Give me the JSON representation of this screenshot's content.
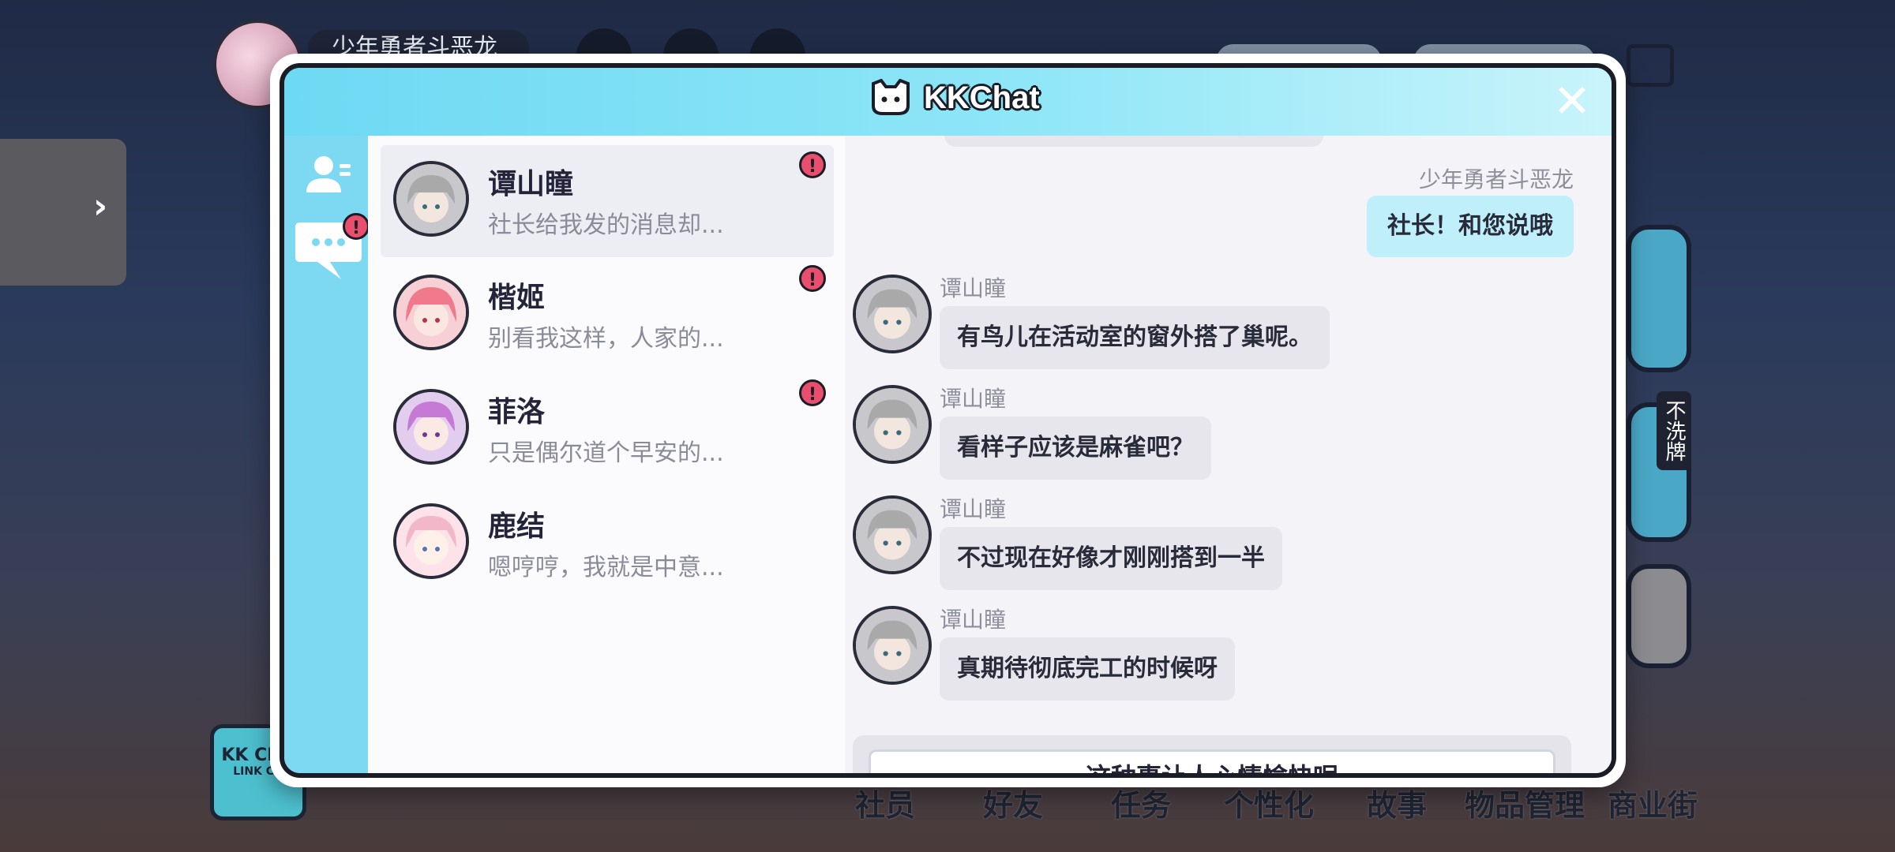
{
  "background": {
    "username": "少年勇者斗恶龙",
    "side_label": "不洗牌",
    "logo_text": "KK CHA",
    "logo_subtext": "LINK CH",
    "nav_tabs": [
      "社员",
      "好友",
      "任务",
      "个性化",
      "故事",
      "物品管理",
      "商业街"
    ]
  },
  "modal": {
    "title": "KKChat",
    "close_glyph": "✕",
    "badge_glyph": "!",
    "contacts": [
      {
        "name": "谭山瞳",
        "preview": "社长给我发的消息却...",
        "unread": true,
        "active": true,
        "hair": "#a9a9a9"
      },
      {
        "name": "楷姬",
        "preview": "别看我这样，人家的...",
        "unread": true,
        "active": false,
        "hair": "#f07a8c"
      },
      {
        "name": "菲洛",
        "preview": "只是偶尔道个早安的...",
        "unread": true,
        "active": false,
        "hair": "#c67ad6"
      },
      {
        "name": "鹿结",
        "preview": "嗯哼哼，我就是中意...",
        "unread": false,
        "active": false,
        "hair": "#f2b7c9"
      }
    ],
    "chat": {
      "me_name": "少年勇者斗恶龙",
      "me_message": "社长！和您说哦",
      "messages": [
        {
          "sender": "谭山瞳",
          "text": "有鸟儿在活动室的窗外搭了巢呢。"
        },
        {
          "sender": "谭山瞳",
          "text": "看样子应该是麻雀吧？"
        },
        {
          "sender": "谭山瞳",
          "text": "不过现在好像才刚刚搭到一半"
        },
        {
          "sender": "谭山瞳",
          "text": "真期待彻底完工的时候呀"
        }
      ],
      "reply_option": "这种事让人心情愉快呢"
    }
  },
  "colors": {
    "header_cyan": "#6ed9f3",
    "badge_pink": "#e94e6d",
    "my_bubble": "#bfeffb",
    "their_bubble": "#e6e6ec"
  }
}
